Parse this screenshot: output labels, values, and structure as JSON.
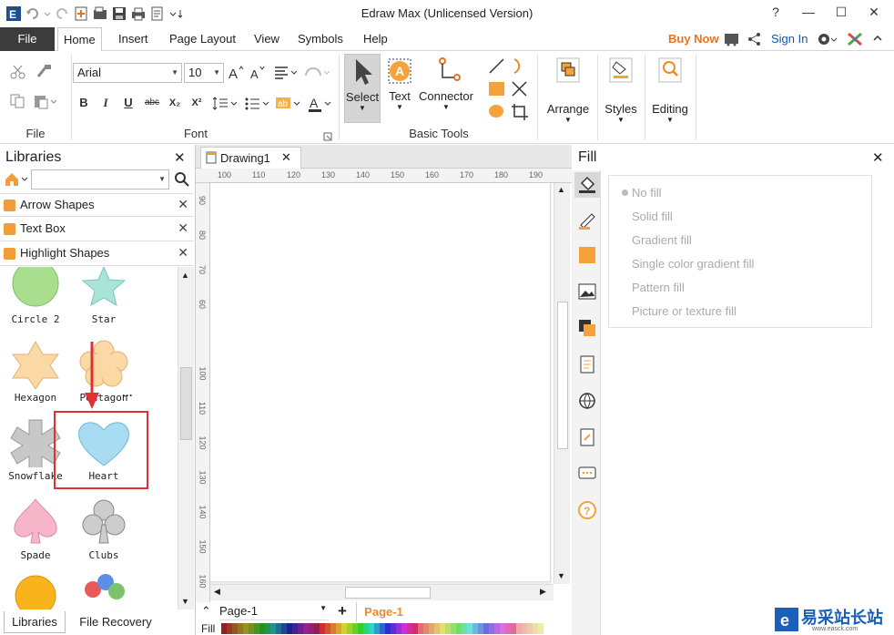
{
  "window": {
    "title": "Edraw Max (Unlicensed Version)",
    "controls": [
      "?",
      "—",
      "☐",
      "✕"
    ]
  },
  "menu": {
    "file": "File",
    "items": [
      "Home",
      "Insert",
      "Page Layout",
      "View",
      "Symbols",
      "Help"
    ],
    "buy_now": "Buy Now",
    "sign_in": "Sign In"
  },
  "ribbon": {
    "font_name": "Arial",
    "font_size": "10",
    "groups": {
      "file": "File",
      "font": "Font",
      "basic_tools": "Basic Tools"
    },
    "buttons": {
      "select": "Select",
      "text": "Text",
      "connector": "Connector",
      "arrange": "Arrange",
      "styles": "Styles",
      "editing": "Editing"
    },
    "format": {
      "bold": "B",
      "italic": "I",
      "underline": "U",
      "strike": "abc",
      "subscript": "X₂",
      "superscript": "X²"
    }
  },
  "libraries": {
    "title": "Libraries",
    "categories": [
      "Arrow Shapes",
      "Text Box",
      "Highlight Shapes"
    ],
    "shapes": [
      "Circle 2",
      "Star",
      "Hexagon",
      "Pentagon",
      "Snowflake",
      "Heart",
      "Spade",
      "Clubs"
    ],
    "ellipsis": "···",
    "bottom_tabs": [
      "Libraries",
      "File Recovery"
    ]
  },
  "document": {
    "tab": "Drawing1",
    "ruler_h": [
      "100",
      "110",
      "120",
      "130",
      "140",
      "150",
      "160",
      "170",
      "180",
      "190"
    ],
    "ruler_v": [
      "90",
      "80",
      "70",
      "60",
      "90",
      "100",
      "110",
      "120",
      "130",
      "140",
      "150",
      "160"
    ],
    "page_selector": "Page-1",
    "active_page": "Page-1",
    "fill_label": "Fill"
  },
  "fill_panel": {
    "title": "Fill",
    "options": [
      "No fill",
      "Solid fill",
      "Gradient fill",
      "Single color gradient fill",
      "Pattern fill",
      "Picture or texture fill"
    ]
  },
  "watermark": {
    "text": "易采站长站",
    "url": "www.easck.com"
  },
  "colors": {
    "accent": "#f0a030",
    "file_tab": "#3c3c3c",
    "highlight_box": "#e03030",
    "heart": "#a8dcf2"
  }
}
